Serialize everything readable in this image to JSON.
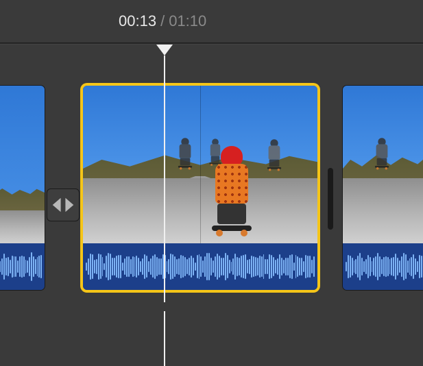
{
  "header": {
    "current_time": "00:13",
    "separator": "/",
    "total_time": "01:10"
  },
  "timeline": {
    "clips": [
      {
        "id": "clip-prev",
        "selected": false
      },
      {
        "id": "clip-current",
        "selected": true
      },
      {
        "id": "clip-next",
        "selected": false
      }
    ],
    "transition": {
      "type": "cross-dissolve"
    },
    "playhead_position_label": "00:13"
  },
  "icons": {
    "transition": "transition-crossfade-icon",
    "playhead": "playhead-icon"
  },
  "colors": {
    "selection": "#f5c518",
    "audio_bg": "#1c3f8a",
    "waveform": "#7db3f5",
    "app_bg": "#3a3a3a"
  }
}
